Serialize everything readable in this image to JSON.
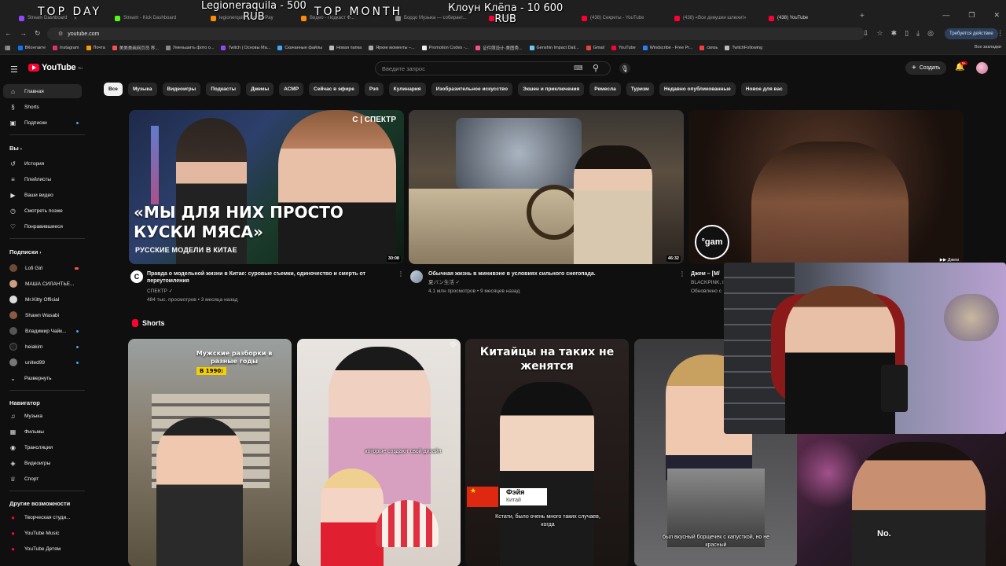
{
  "overlay": {
    "top_day": "TOP DAY",
    "top_day_donor": "Legioneraquila - 500",
    "top_day_amount": "RUB",
    "top_month": "TOP MONTH",
    "top_month_donor": "Клоун Клёпа - 10 600",
    "top_month_amount": "RUB"
  },
  "browser": {
    "tabs": [
      {
        "label": "Stream Dashboard",
        "color": "#9146ff"
      },
      {
        "label": "Stream - Kick Dashboard",
        "color": "#53fc18"
      },
      {
        "label": "legionerquila | DonatePay",
        "color": "#ff8c00"
      },
      {
        "label": "Видео - Подкаст Ф...",
        "color": "#ff8c00"
      },
      {
        "label": "Бордо Музыка — собирает...",
        "color": "#888888"
      },
      {
        "label": "YouTube",
        "color": "#ff0033"
      },
      {
        "label": "(438) Секреты - YouTube",
        "color": "#ff0033"
      },
      {
        "label": "(438) «Все девушки шлюхи!»",
        "color": "#ff0033"
      },
      {
        "label": "(438) YouTube",
        "color": "#ff0033"
      }
    ],
    "url": "youtube.com",
    "update_button": "Требуется действие",
    "bookmarks": [
      {
        "label": "ВКонтакте",
        "color": "#0077ff"
      },
      {
        "label": "Instagram",
        "color": "#e1306c"
      },
      {
        "label": "Почта",
        "color": "#ff9900"
      },
      {
        "label": "美美美画网页员 界...",
        "color": "#ff4d4d"
      },
      {
        "label": "Уменьшить фото о...",
        "color": "#888888"
      },
      {
        "label": "Twitch | Основы Ма...",
        "color": "#9146ff"
      },
      {
        "label": "Скачанные файлы",
        "color": "#3ea6ff"
      },
      {
        "label": "Новая папка",
        "color": "#bbbbbb"
      },
      {
        "label": "Яркие моменты –...",
        "color": "#aaaaaa"
      },
      {
        "label": "Promotion Codes -...",
        "color": "#eeeeee"
      },
      {
        "label": "证件照设计-美图秀...",
        "color": "#ff4d88"
      },
      {
        "label": "Genshin Impact Dail...",
        "color": "#66ccff"
      },
      {
        "label": "Gmail",
        "color": "#ea4335"
      },
      {
        "label": "YouTube",
        "color": "#ff0033"
      },
      {
        "label": "Windscribe - Free Pr...",
        "color": "#2a7fff"
      },
      {
        "label": "связь",
        "color": "#ff3b3b"
      },
      {
        "label": "TwitchFollowing",
        "color": "#bbbbbb"
      }
    ],
    "bookmarks_right": "Все закладки"
  },
  "header": {
    "logo_text": "YouTube",
    "logo_region": "RU",
    "search_placeholder": "Введите запрос",
    "create_label": "Создать",
    "bell_badge": "9+"
  },
  "sidebar": {
    "main": [
      {
        "label": "Главная",
        "icon": "home-icon",
        "glyph": "⌂"
      },
      {
        "label": "Shorts",
        "icon": "shorts-icon",
        "glyph": "§"
      },
      {
        "label": "Подписки",
        "icon": "subscriptions-icon",
        "glyph": "▣"
      }
    ],
    "you_heading": "Вы",
    "you": [
      {
        "label": "История",
        "icon": "history-icon",
        "glyph": "↺"
      },
      {
        "label": "Плейлисты",
        "icon": "playlists-icon",
        "glyph": "≡"
      },
      {
        "label": "Ваши видео",
        "icon": "your-videos-icon",
        "glyph": "▶"
      },
      {
        "label": "Смотреть позже",
        "icon": "watch-later-icon",
        "glyph": "◷"
      },
      {
        "label": "Понравившиеся",
        "icon": "liked-icon",
        "glyph": "👍"
      }
    ],
    "subs_heading": "Подписки",
    "subs": [
      {
        "label": "Lofi Girl",
        "color": "#6b4a3a"
      },
      {
        "label": "МАША СИЛАНТЬЕ...",
        "color": "#caa080"
      },
      {
        "label": "Mr.Kitty Official",
        "color": "#dddddd"
      },
      {
        "label": "Shawn Wasabi",
        "color": "#8a5a44"
      },
      {
        "label": "Владимир Чайк...",
        "color": "#555555"
      },
      {
        "label": "heiakim",
        "color": "#222222"
      },
      {
        "label": "united99",
        "color": "#777777"
      }
    ],
    "expand_label": "Развернуть",
    "nav_heading": "Навигатор",
    "nav": [
      {
        "label": "Музыка",
        "icon": "music-icon",
        "glyph": "♫"
      },
      {
        "label": "Фильмы",
        "icon": "movies-icon",
        "glyph": "▦"
      },
      {
        "label": "Трансляции",
        "icon": "live-icon",
        "glyph": "◉"
      },
      {
        "label": "Видеоигры",
        "icon": "gaming-icon",
        "glyph": "◈"
      },
      {
        "label": "Спорт",
        "icon": "sports-icon",
        "glyph": "♕"
      }
    ],
    "more_heading": "Другие возможности",
    "more": [
      {
        "label": "Творческая студи...",
        "icon": "studio-icon"
      },
      {
        "label": "YouTube Music",
        "icon": "yt-music-icon"
      },
      {
        "label": "YouTube Детям",
        "icon": "yt-kids-icon"
      }
    ]
  },
  "chips": [
    "Все",
    "Музыка",
    "Видеоигры",
    "Подкасты",
    "Джемы",
    "АСМР",
    "Сейчас в эфире",
    "Рэп",
    "Кулинария",
    "Изобразительное искусство",
    "Экшен и приключения",
    "Ремесла",
    "Туризм",
    "Недавно опубликованные",
    "Новое для вас"
  ],
  "videos": [
    {
      "title": "Правда о модельной жизни в Китае: суровые съемки, одиночество и смерть от переутомления",
      "channel": "СПЕКТР",
      "meta": "484 тыс. просмотров • 3 месяца назад",
      "duration": "30:08",
      "thumb_headline": "«МЫ ДЛЯ НИХ ПРОСТО КУСКИ МЯСА»",
      "thumb_sub": "РУССКИЕ МОДЕЛИ В КИТАЕ",
      "thumb_badge": "С | СПЕКТР"
    },
    {
      "title": "Обычная жизнь в минивэне в условиях сильного снегопада.",
      "channel": "夏バン生活",
      "meta": "4,1 млн просмотров • 9 месяцев назад",
      "duration": "46:32"
    },
    {
      "title": "Джем – [M/",
      "channel": "BLACKPINK, l",
      "meta": "Обновлено с",
      "thumb_badge": "Джем"
    }
  ],
  "shorts": {
    "heading": "Shorts",
    "items": [
      {
        "text": "Мужские разборки в разные годы",
        "tag": "В 1990:"
      },
      {
        "caption": "которые создают свой дизайн"
      },
      {
        "text": "Китайцы на таких не женятся",
        "name": "Фэйя",
        "country": "Китай",
        "caption": "Кстати, было очень много таких случаев, когда"
      },
      {
        "caption": "был вкусный борщечек с капусткой, но не красный"
      }
    ]
  },
  "webcam": {
    "caption": "No."
  }
}
